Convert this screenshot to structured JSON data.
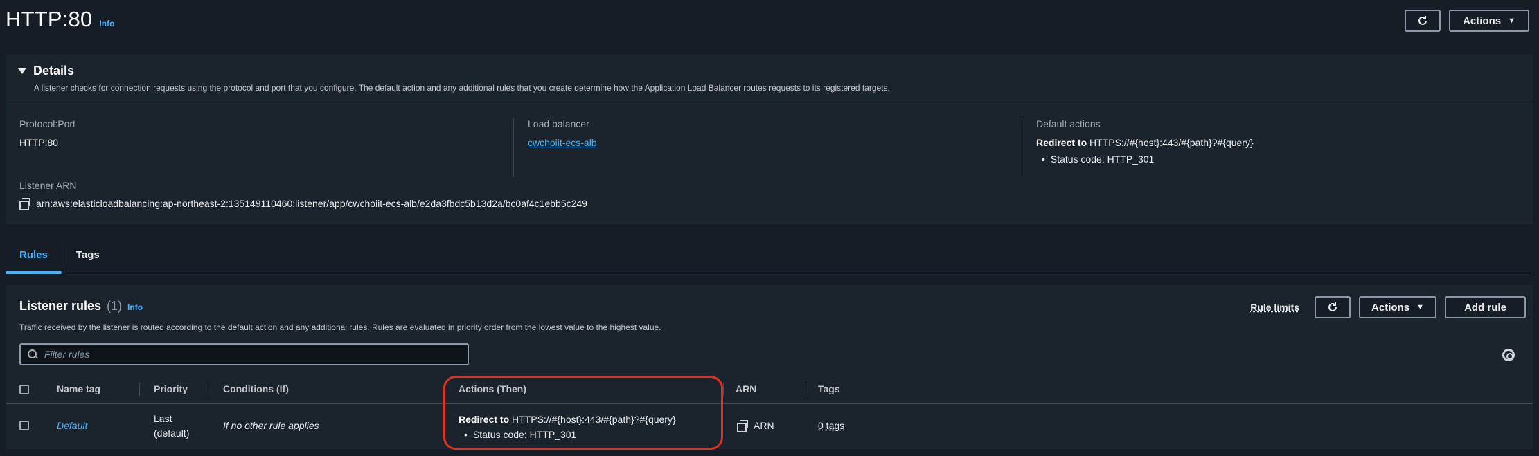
{
  "header": {
    "title": "HTTP:80",
    "info": "Info",
    "actions_label": "Actions"
  },
  "details": {
    "title": "Details",
    "description": "A listener checks for connection requests using the protocol and port that you configure. The default action and any additional rules that you create determine how the Application Load Balancer routes requests to its registered targets.",
    "protocol_port_label": "Protocol:Port",
    "protocol_port_value": "HTTP:80",
    "load_balancer_label": "Load balancer",
    "load_balancer_value": "cwchoiit-ecs-alb",
    "default_actions_label": "Default actions",
    "default_action_prefix": "Redirect to",
    "default_action_target": "HTTPS://#{host}:443/#{path}?#{query}",
    "default_action_status": "Status code: HTTP_301",
    "listener_arn_label": "Listener ARN",
    "listener_arn_value": "arn:aws:elasticloadbalancing:ap-northeast-2:135149110460:listener/app/cwchoiit-ecs-alb/e2da3fbdc5b13d2a/bc0af4c1ebb5c249"
  },
  "tabs": [
    {
      "label": "Rules",
      "active": true
    },
    {
      "label": "Tags",
      "active": false
    }
  ],
  "rules": {
    "title": "Listener rules",
    "count": "(1)",
    "info": "Info",
    "description": "Traffic received by the listener is routed according to the default action and any additional rules. Rules are evaluated in priority order from the lowest value to the highest value.",
    "rule_limits_label": "Rule limits",
    "actions_label": "Actions",
    "add_rule_label": "Add rule",
    "filter_placeholder": "Filter rules",
    "columns": {
      "name_tag": "Name tag",
      "priority": "Priority",
      "conditions": "Conditions (If)",
      "actions": "Actions (Then)",
      "arn": "ARN",
      "tags": "Tags"
    },
    "rows": [
      {
        "name_tag": "Default",
        "priority_line1": "Last",
        "priority_line2": "(default)",
        "conditions": "If no other rule applies",
        "action_prefix": "Redirect to",
        "action_target": "HTTPS://#{host}:443/#{path}?#{query}",
        "action_status": "Status code: HTTP_301",
        "arn": "ARN",
        "tags": "0 tags"
      }
    ]
  },
  "colors": {
    "accent": "#42b4ff",
    "highlight": "#e0301e",
    "background": "#161d26",
    "panel": "#1b232d"
  }
}
